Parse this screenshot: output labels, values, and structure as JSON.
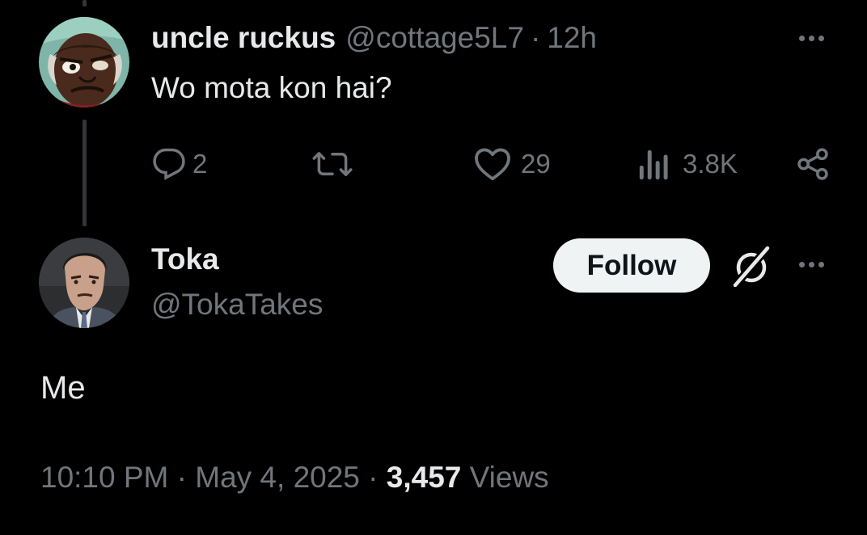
{
  "parent_tweet": {
    "display_name": "uncle ruckus",
    "handle": "@cottage5L7",
    "separator": "·",
    "time_ago": "12h",
    "text": "Wo mota kon hai?",
    "replies": "2",
    "reposts": "",
    "likes": "29",
    "views": "3.8K"
  },
  "reply_tweet": {
    "display_name": "Toka",
    "handle": "@TokaTakes",
    "follow_label": "Follow",
    "text": "Me",
    "timestamp": "10:10 PM · May 4, 2025",
    "meta_separator": " · ",
    "view_count": "3,457",
    "views_label": " Views"
  },
  "icons": {
    "reply": "reply-icon",
    "repost": "repost-icon",
    "like": "like-icon",
    "views": "views-icon",
    "share": "share-icon",
    "more": "more-icon",
    "grok": "grok-icon"
  },
  "colors": {
    "background": "#000000",
    "primary_text": "#e7e9ea",
    "secondary_text": "#71767b",
    "thread_line": "#333639",
    "follow_button_bg": "#eff3f4",
    "follow_button_text": "#0f1419"
  }
}
